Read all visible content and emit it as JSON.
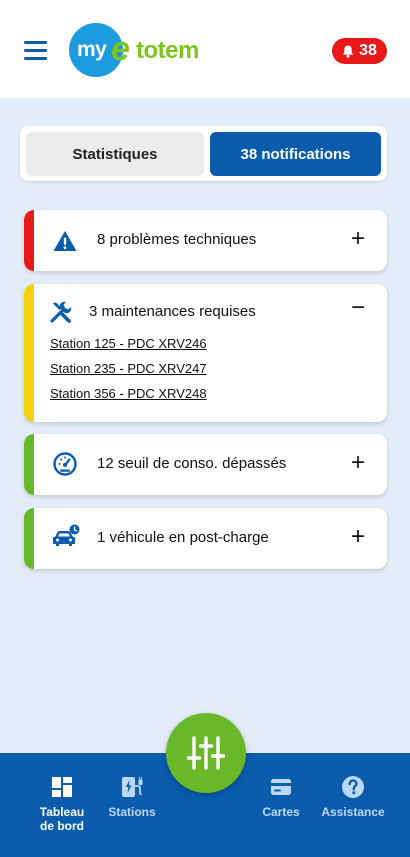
{
  "header": {
    "logo": {
      "my": "my",
      "e": "e",
      "totem": "totem"
    },
    "notifications_count": "38",
    "colors": {
      "primary": "#0b5cad",
      "logo_blue": "#1d9be0",
      "logo_green": "#7dc41e",
      "badge_red": "#e81919"
    }
  },
  "tabs": {
    "statistics": "Statistiques",
    "notifications": "38 notifications"
  },
  "alerts": [
    {
      "title": "8 problèmes techniques",
      "toggle": "+",
      "color": "#e81919",
      "icon": "warning-icon"
    },
    {
      "title": "3 maintenances requises",
      "toggle": "−",
      "color": "#f5d110",
      "icon": "tools-icon",
      "links": [
        "Station 125 - PDC XRV246",
        "Station 235 - PDC XRV247",
        "Station 356 - PDC XRV248"
      ]
    },
    {
      "title": "12 seuil de conso. dépassés",
      "toggle": "+",
      "color": "#68b82a",
      "icon": "gauge-icon"
    },
    {
      "title": "1 véhicule en post-charge",
      "toggle": "+",
      "color": "#68b82a",
      "icon": "car-clock-icon"
    }
  ],
  "bottom_nav": {
    "dashboard_line1": "Tableau",
    "dashboard_line2": "de bord",
    "stations": "Stations",
    "cards": "Cartes",
    "support": "Assistance"
  }
}
